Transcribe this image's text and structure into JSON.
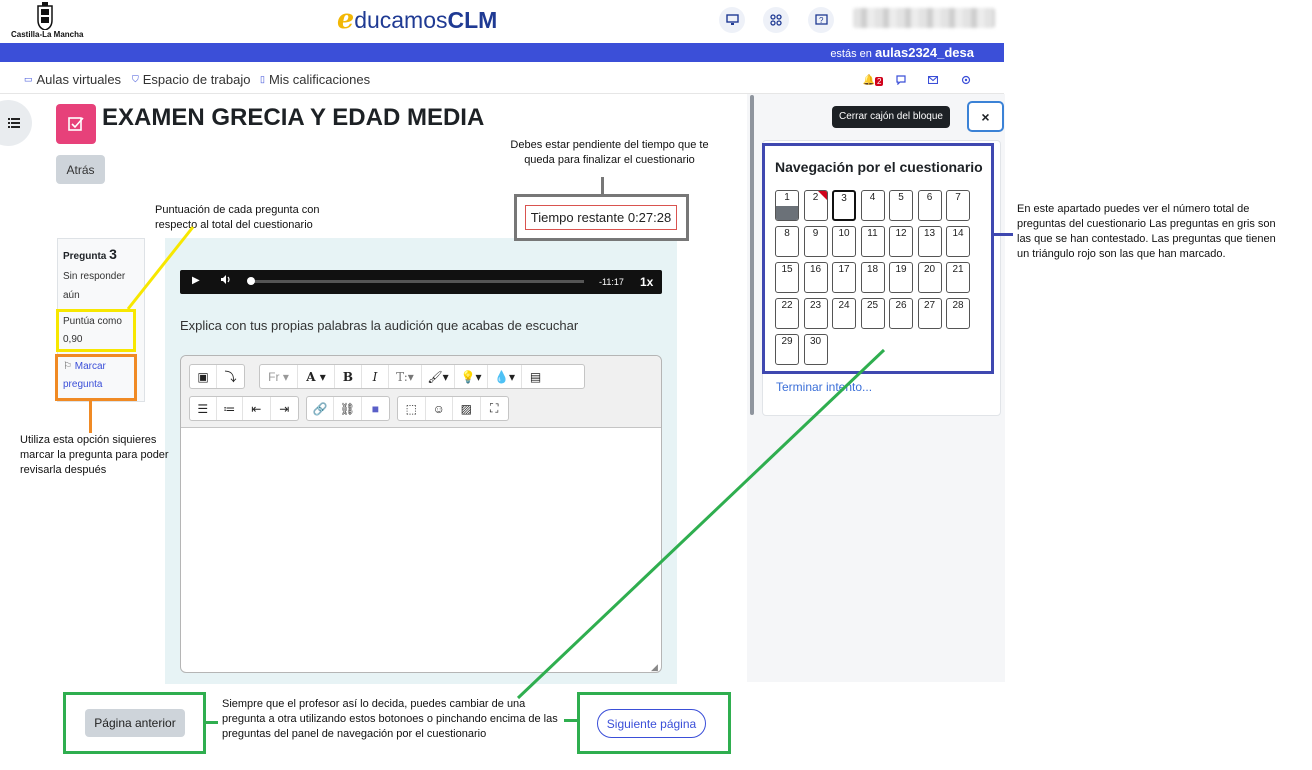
{
  "header": {
    "region_name": "Castilla-La Mancha",
    "brand_rest": "ducamos",
    "brand_strong": "CLM",
    "location_prefix": "estás en",
    "location_site": "aulas2324_desa"
  },
  "nav": {
    "aulas": "Aulas virtuales",
    "workspace": "Espacio de trabajo",
    "grades": "Mis calificaciones",
    "notifications_count": "2"
  },
  "quiz": {
    "title": "EXAMEN GRECIA Y EDAD MEDIA",
    "back_label": "Atrás",
    "question_label": "Pregunta",
    "question_number": "3",
    "status": "Sin responder aún",
    "marks": "Puntúa como 0,90",
    "flag_label": "Marcar pregunta",
    "question_text": "Explica con tus propias palabras la audición que acabas de escuchar",
    "audio_time": "-11:17",
    "audio_rate": "1x",
    "audio_progress": 0
  },
  "editor": {
    "font_label": "Fr",
    "font_color_label": "A",
    "bold_label": "B",
    "italic_label": "I",
    "font_size_label": "T:"
  },
  "timer": {
    "text": "Tiempo restante 0:27:28"
  },
  "drawer": {
    "close_tooltip": "Cerrar cajón del bloque",
    "close_icon": "×",
    "nav_title": "Navegación por el cuestionario",
    "finish_link": "Terminar intento...",
    "questions": [
      {
        "n": "1",
        "answered": true
      },
      {
        "n": "2",
        "flagged": true
      },
      {
        "n": "3",
        "current": true
      },
      {
        "n": "4"
      },
      {
        "n": "5"
      },
      {
        "n": "6"
      },
      {
        "n": "7"
      },
      {
        "n": "8"
      },
      {
        "n": "9"
      },
      {
        "n": "10"
      },
      {
        "n": "11"
      },
      {
        "n": "12"
      },
      {
        "n": "13"
      },
      {
        "n": "14"
      },
      {
        "n": "15"
      },
      {
        "n": "16"
      },
      {
        "n": "17"
      },
      {
        "n": "18"
      },
      {
        "n": "19"
      },
      {
        "n": "20"
      },
      {
        "n": "21"
      },
      {
        "n": "22"
      },
      {
        "n": "23"
      },
      {
        "n": "24"
      },
      {
        "n": "25"
      },
      {
        "n": "26"
      },
      {
        "n": "27"
      },
      {
        "n": "28"
      },
      {
        "n": "29"
      },
      {
        "n": "30"
      }
    ]
  },
  "paging": {
    "prev": "Página anterior",
    "next": "Siguiente página"
  },
  "notes": {
    "score": "Puntuación de cada pregunta con respecto al total del cuestionario",
    "timer": "Debes estar pendiente del tiempo que te queda para finalizar el cuestionario",
    "flag": "Utiliza esta opción siquieres marcar la pregunta para poder revisarla después",
    "nav": "En este apartado puedes ver el número total de preguntas del cuestionario Las preguntas en gris son las que se han contestado. Las preguntas que tienen un triángulo rojo son las que han marcado.",
    "paging": "Siempre que el profesor así lo decida, puedes cambiar de una pregunta a otra utilizando estos botonoes o pinchando encima de las preguntas del panel de navegación por el cuestionario"
  },
  "colors": {
    "brand_blue": "#3b4fd8",
    "quiz_pink": "#e7417a",
    "note_yellow": "#f7e700",
    "note_orange": "#f08a24",
    "note_green": "#2fae4f",
    "note_navy": "#3f48b0",
    "flag_red": "#d0021b"
  }
}
